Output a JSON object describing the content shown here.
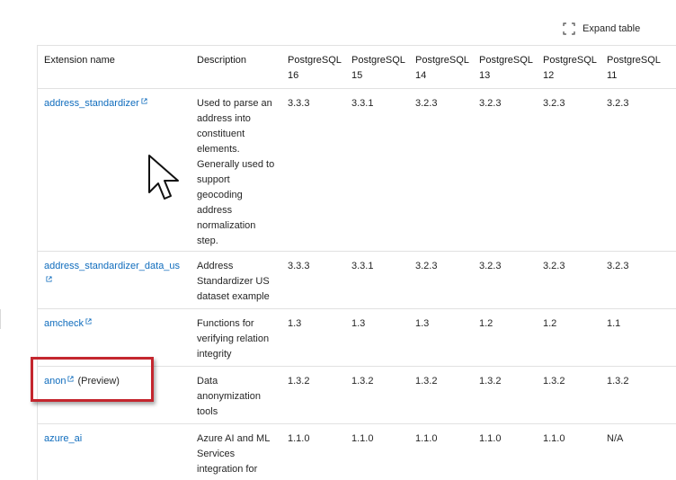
{
  "toolbar": {
    "expand_label": "Expand table"
  },
  "table": {
    "headers": {
      "name": "Extension name",
      "description": "Description",
      "pg16": [
        "PostgreSQL",
        "16"
      ],
      "pg15": [
        "PostgreSQL",
        "15"
      ],
      "pg14": [
        "PostgreSQL",
        "14"
      ],
      "pg13": [
        "PostgreSQL",
        "13"
      ],
      "pg12": [
        "PostgreSQL",
        "12"
      ],
      "pg11": [
        "PostgreSQL",
        "11"
      ]
    },
    "rows": [
      {
        "name": "address_standardizer",
        "preview": "",
        "description": "Used to parse an address into constituent elements. Generally used to support geocoding address normalization step.",
        "pg16": "3.3.3",
        "pg15": "3.3.1",
        "pg14": "3.2.3",
        "pg13": "3.2.3",
        "pg12": "3.2.3",
        "pg11": "3.2.3"
      },
      {
        "name": "address_standardizer_data_us",
        "preview": "",
        "description": "Address Standardizer US dataset example",
        "pg16": "3.3.3",
        "pg15": "3.3.1",
        "pg14": "3.2.3",
        "pg13": "3.2.3",
        "pg12": "3.2.3",
        "pg11": "3.2.3"
      },
      {
        "name": "amcheck",
        "preview": "",
        "description": "Functions for verifying relation integrity",
        "pg16": "1.3",
        "pg15": "1.3",
        "pg14": "1.3",
        "pg13": "1.2",
        "pg12": "1.2",
        "pg11": "1.1"
      },
      {
        "name": "anon",
        "preview": "(Preview)",
        "description": "Data anonymization tools",
        "pg16": "1.3.2",
        "pg15": "1.3.2",
        "pg14": "1.3.2",
        "pg13": "1.3.2",
        "pg12": "1.3.2",
        "pg11": "1.3.2"
      },
      {
        "name": "azure_ai",
        "preview": "",
        "description": "Azure AI and ML Services integration for",
        "pg16": "1.1.0",
        "pg15": "1.1.0",
        "pg14": "1.1.0",
        "pg13": "1.1.0",
        "pg12": "1.1.0",
        "pg11": "N/A"
      }
    ]
  },
  "colors": {
    "link": "#0f6cbd",
    "highlight": "#c4262e",
    "border": "#e1e1e1"
  },
  "icons": {
    "expand": "expand-icon",
    "external": "external-link-icon",
    "cursor": "mouse-cursor-icon"
  }
}
